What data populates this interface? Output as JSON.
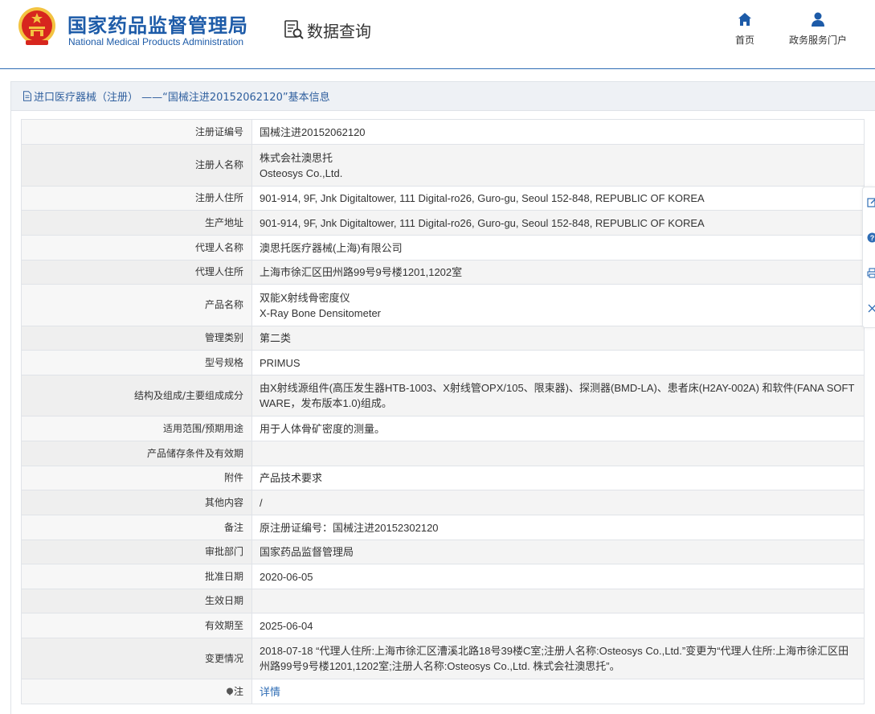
{
  "header": {
    "org_cn": "国家药品监督管理局",
    "org_en": "National Medical Products Administration",
    "section_title": "数据查询",
    "nav": [
      {
        "label": "首页",
        "icon": "home-icon"
      },
      {
        "label": "政务服务门户",
        "icon": "user-icon"
      }
    ]
  },
  "breadcrumb": {
    "text": "进口医疗器械（注册） ——“国械注进20152062120”基本信息",
    "icon": "document-icon"
  },
  "details": {
    "rows": [
      {
        "label": "注册证编号",
        "value": "国械注进20152062120"
      },
      {
        "label": "注册人名称",
        "value": "株式会社澳思托",
        "value2": "Osteosys Co.,Ltd."
      },
      {
        "label": "注册人住所",
        "value": "901-914, 9F, Jnk Digitaltower, 111 Digital-ro26, Guro-gu, Seoul 152-848, REPUBLIC OF KOREA"
      },
      {
        "label": "生产地址",
        "value": "901-914, 9F, Jnk Digitaltower, 111 Digital-ro26, Guro-gu, Seoul 152-848, REPUBLIC OF KOREA"
      },
      {
        "label": "代理人名称",
        "value": "澳思托医疗器械(上海)有限公司"
      },
      {
        "label": "代理人住所",
        "value": "上海市徐汇区田州路99号9号楼1201,1202室"
      },
      {
        "label": "产品名称",
        "value": "双能X射线骨密度仪",
        "value2": "X-Ray Bone Densitometer"
      },
      {
        "label": "管理类别",
        "value": "第二类"
      },
      {
        "label": "型号规格",
        "value": "PRIMUS"
      },
      {
        "label": "结构及组成/主要组成成分",
        "value": "由X射线源组件(高压发生器HTB-1003、X射线管OPX/105、限束器)、探测器(BMD-LA)、患者床(H2AY-002A) 和软件(FANA SOFTWARE，发布版本1.0)组成。"
      },
      {
        "label": "适用范围/预期用途",
        "value": "用于人体骨矿密度的测量。"
      },
      {
        "label": "产品储存条件及有效期",
        "value": ""
      },
      {
        "label": "附件",
        "value": "产品技术要求"
      },
      {
        "label": "其他内容",
        "value": "/"
      },
      {
        "label": "备注",
        "value": "原注册证编号：国械注进20152302120"
      },
      {
        "label": "审批部门",
        "value": "国家药品监督管理局"
      },
      {
        "label": "批准日期",
        "value": "2020-06-05"
      },
      {
        "label": "生效日期",
        "value": ""
      },
      {
        "label": "有效期至",
        "value": "2025-06-04"
      },
      {
        "label": "变更情况",
        "value": "2018-07-18 “代理人住所:上海市徐汇区漕溪北路18号39楼C室;注册人名称:Osteosys Co.,Ltd.”变更为“代理人住所:上海市徐汇区田州路99号9号楼1201,1202室;注册人名称:Osteosys Co.,Ltd. 株式会社澳思托”。"
      },
      {
        "label": "注",
        "value": "详情",
        "label_icon": "pin-icon"
      }
    ]
  },
  "tools": [
    "edit-icon",
    "help-icon",
    "print-icon",
    "close-icon"
  ],
  "colors": {
    "brand": "#1d5ba8",
    "link": "#2f6db5",
    "emblem_red": "#d7261e",
    "emblem_gold": "#f3c341"
  }
}
